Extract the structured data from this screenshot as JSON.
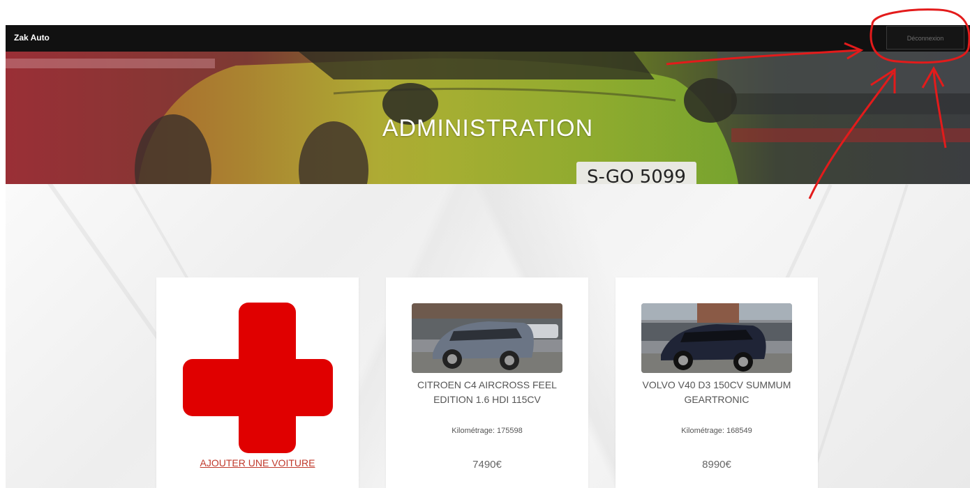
{
  "navbar": {
    "brand": "Zak Auto",
    "logout_label": "Déconnexion"
  },
  "hero": {
    "title": "ADMINISTRATION",
    "plate": "S-GO 5099"
  },
  "add_card": {
    "icon": "plus-icon",
    "link_label": "AJOUTER UNE VOITURE"
  },
  "cars": [
    {
      "title": "CITROEN C4 AIRCROSS FEEL EDITION 1.6 HDI 115CV",
      "mileage": "Kilométrage: 175598",
      "price": "7490€"
    },
    {
      "title": "VOLVO V40 D3 150CV SUMMUM GEARTRONIC",
      "mileage": "Kilométrage: 168549",
      "price": "8990€"
    }
  ],
  "colors": {
    "navbar": "#111111",
    "accent_red": "#e00000",
    "link_red": "#c0392b",
    "annotation_red": "#e31b1b"
  }
}
